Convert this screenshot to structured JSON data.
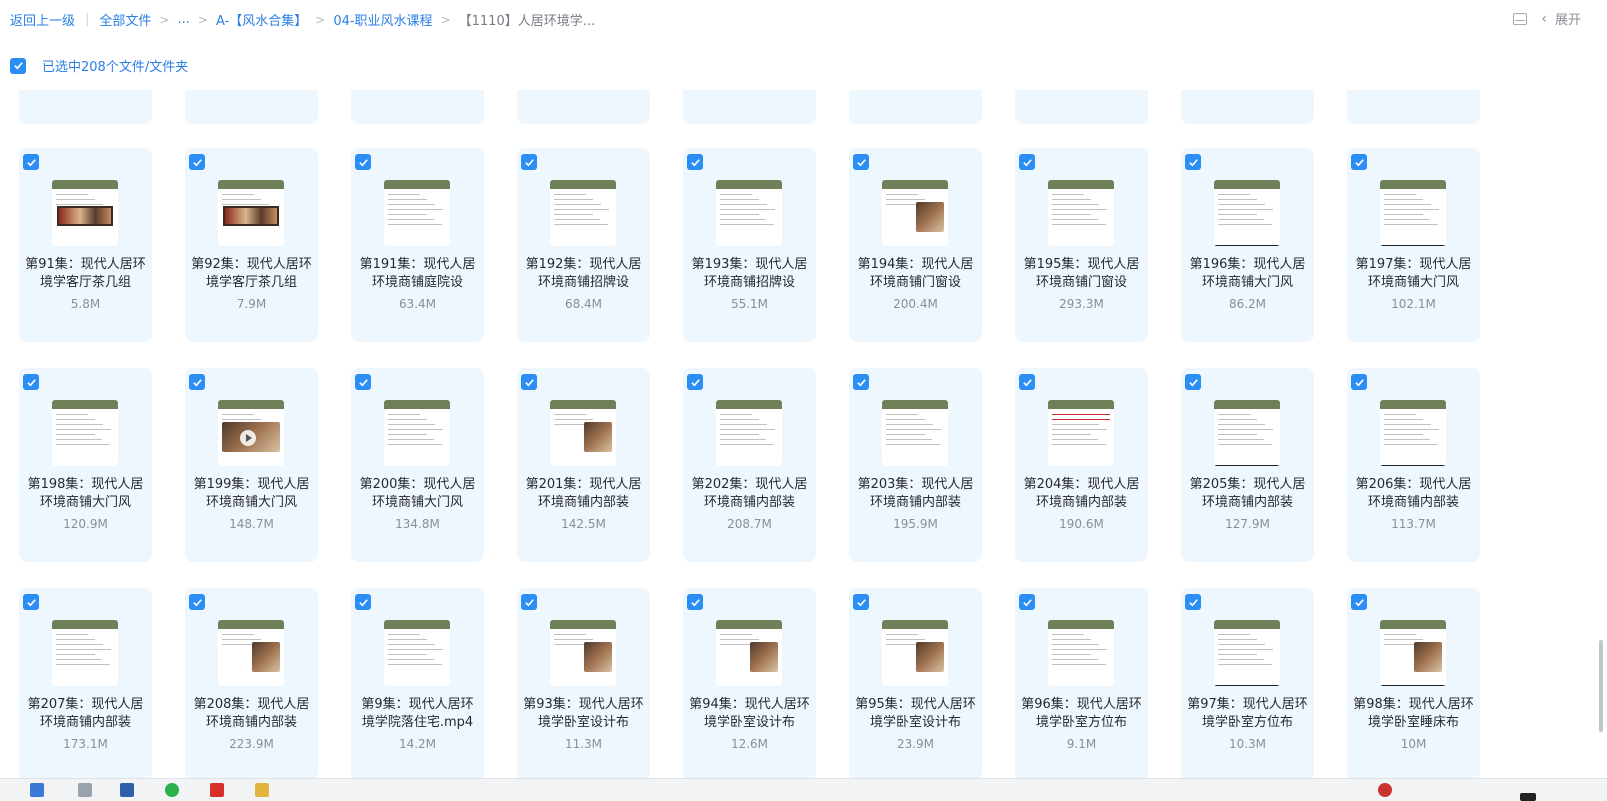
{
  "breadcrumb": {
    "back": "返回上一级",
    "all_files": "全部文件",
    "ellipsis": "...",
    "folder1": "A-【风水合集】",
    "folder2": "04-职业风水课程",
    "current": "【1110】人居环境学..."
  },
  "toolbar": {
    "expand_label": "展开"
  },
  "selection": {
    "text": "已选中208个文件/文件夹"
  },
  "colors": {
    "accent": "#2a7ee6",
    "checkbox": "#2b8ef5",
    "card_bg": "#eef7fd",
    "thumb_header": "#6f7f57"
  },
  "files": [
    {
      "name": "第91集：现代人居环境学客厅茶几组",
      "size": "5.8M"
    },
    {
      "name": "第92集：现代人居环境学客厅茶几组",
      "size": "7.9M"
    },
    {
      "name": "第191集：现代人居环境商铺庭院设",
      "size": "63.4M"
    },
    {
      "name": "第192集：现代人居环境商铺招牌设",
      "size": "68.4M"
    },
    {
      "name": "第193集：现代人居环境商铺招牌设",
      "size": "55.1M"
    },
    {
      "name": "第194集：现代人居环境商铺门窗设",
      "size": "200.4M"
    },
    {
      "name": "第195集：现代人居环境商铺门窗设",
      "size": "293.3M"
    },
    {
      "name": "第196集：现代人居环境商铺大门风",
      "size": "86.2M"
    },
    {
      "name": "第197集：现代人居环境商铺大门风",
      "size": "102.1M"
    },
    {
      "name": "第198集：现代人居环境商铺大门风",
      "size": "120.9M"
    },
    {
      "name": "第199集：现代人居环境商铺大门风",
      "size": "148.7M"
    },
    {
      "name": "第200集：现代人居环境商铺大门风",
      "size": "134.8M"
    },
    {
      "name": "第201集：现代人居环境商铺内部装",
      "size": "142.5M"
    },
    {
      "name": "第202集：现代人居环境商铺内部装",
      "size": "208.7M"
    },
    {
      "name": "第203集：现代人居环境商铺内部装",
      "size": "195.9M"
    },
    {
      "name": "第204集：现代人居环境商铺内部装",
      "size": "190.6M"
    },
    {
      "name": "第205集：现代人居环境商铺内部装",
      "size": "127.9M"
    },
    {
      "name": "第206集：现代人居环境商铺内部装",
      "size": "113.7M"
    },
    {
      "name": "第207集：现代人居环境商铺内部装",
      "size": "173.1M"
    },
    {
      "name": "第208集：现代人居环境商铺内部装",
      "size": "223.9M"
    },
    {
      "name": "第9集：现代人居环境学院落住宅.mp4",
      "size": "14.2M"
    },
    {
      "name": "第93集：现代人居环境学卧室设计布",
      "size": "11.3M"
    },
    {
      "name": "第94集：现代人居环境学卧室设计布",
      "size": "12.6M"
    },
    {
      "name": "第95集：现代人居环境学卧室设计布",
      "size": "23.9M"
    },
    {
      "name": "第96集：现代人居环境学卧室方位布",
      "size": "9.1M"
    },
    {
      "name": "第97集：现代人居环境学卧室方位布",
      "size": "10.3M"
    },
    {
      "name": "第98集：现代人居环境学卧室睡床布",
      "size": "10M"
    }
  ]
}
